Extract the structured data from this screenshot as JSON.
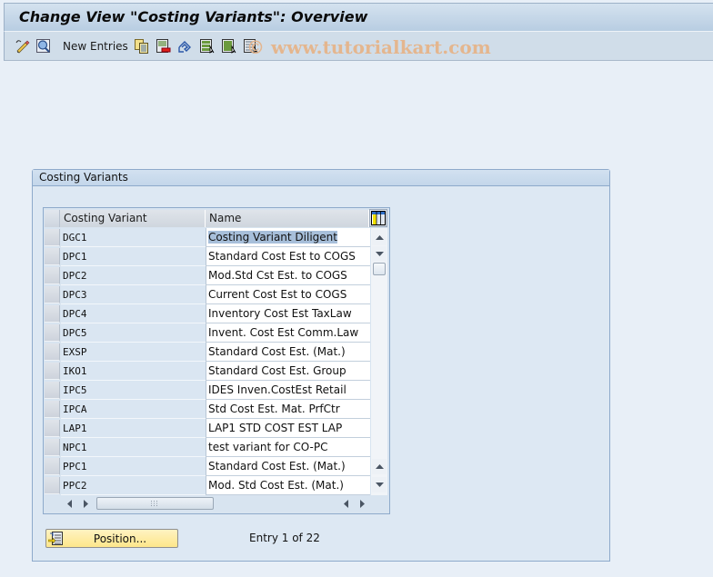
{
  "window": {
    "title": "Change View \"Costing Variants\": Overview"
  },
  "toolbar": {
    "icons": [
      "display-change-icon",
      "where-used-icon"
    ],
    "new_entries_label": "New Entries",
    "action_icons": [
      "copy-as-icon",
      "delete-icon",
      "undo-change-icon",
      "select-all-icon",
      "select-block-icon",
      "deselect-all-icon"
    ]
  },
  "watermark": "© www.tutorialkart.com",
  "group": {
    "title": "Costing Variants"
  },
  "table": {
    "columns": [
      "Costing Variant",
      "Name"
    ],
    "rows": [
      {
        "variant": "DGC1",
        "name": "Costing Variant Diligent",
        "selected": true
      },
      {
        "variant": "DPC1",
        "name": "Standard Cost Est to COGS"
      },
      {
        "variant": "DPC2",
        "name": "Mod.Std Cst Est. to COGS"
      },
      {
        "variant": "DPC3",
        "name": "Current Cost Est to COGS"
      },
      {
        "variant": "DPC4",
        "name": "Inventory Cost Est TaxLaw"
      },
      {
        "variant": "DPC5",
        "name": "Invent. Cost Est Comm.Law"
      },
      {
        "variant": "EXSP",
        "name": "Standard Cost Est. (Mat.)"
      },
      {
        "variant": "IKO1",
        "name": "Standard Cost Est. Group"
      },
      {
        "variant": "IPC5",
        "name": "IDES Inven.CostEst Retail"
      },
      {
        "variant": "IPCA",
        "name": "Std Cost Est. Mat. PrfCtr"
      },
      {
        "variant": "LAP1",
        "name": "LAP1 STD COST EST LAP"
      },
      {
        "variant": "NPC1",
        "name": "test variant for CO-PC"
      },
      {
        "variant": "PPC1",
        "name": "Standard Cost Est. (Mat.)"
      },
      {
        "variant": "PPC2",
        "name": "Mod. Std Cost Est. (Mat.)"
      }
    ]
  },
  "footer": {
    "position_button": "Position...",
    "entry_info": "Entry 1 of 22"
  }
}
